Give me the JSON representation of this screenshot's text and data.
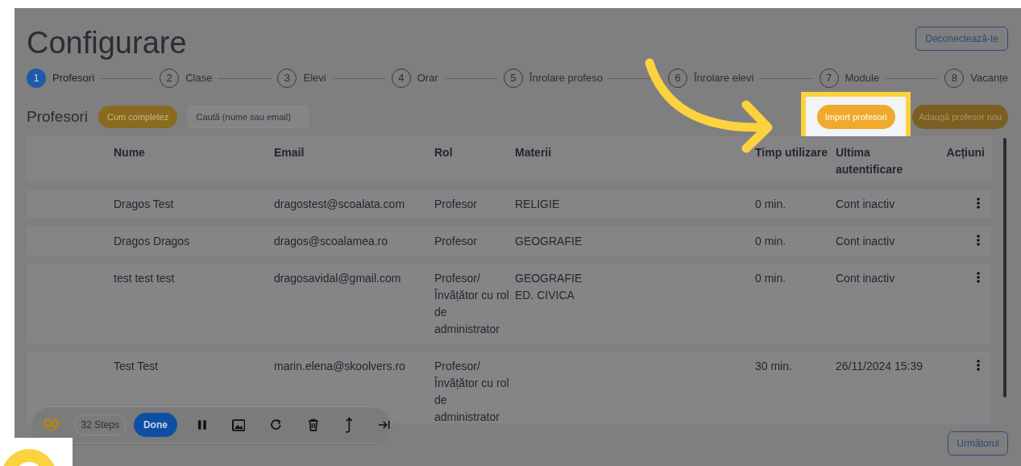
{
  "title": "Configurare",
  "logout_button": "Deconectează-te",
  "steps": [
    {
      "number": "1",
      "label": "Profesori",
      "selected": true
    },
    {
      "number": "2",
      "label": "Clase",
      "selected": false
    },
    {
      "number": "3",
      "label": "Elevi",
      "selected": false
    },
    {
      "number": "4",
      "label": "Orar",
      "selected": false
    },
    {
      "number": "5",
      "label": "Înrolare profeso",
      "selected": false
    },
    {
      "number": "6",
      "label": "Înrolare elevi",
      "selected": false
    },
    {
      "number": "7",
      "label": "Module",
      "selected": false
    },
    {
      "number": "8",
      "label": "Vacanțe",
      "selected": false
    }
  ],
  "section_title": "Profesori",
  "help_button": "Cum completez",
  "search": {
    "placeholder": "Caută (nume sau email)"
  },
  "import_button": "Import profesori",
  "add_button": "Adaugă profesor nou",
  "table": {
    "columns": [
      "Nume",
      "Email",
      "Rol",
      "Materii",
      "Timp utilizare",
      "Ultima autentificare",
      "Acțiuni"
    ],
    "rows": [
      {
        "name": "Dragos Test",
        "email": "dragostest@scoalata.com",
        "role": "Profesor",
        "subjects": [
          "RELIGIE"
        ],
        "time": "0 min.",
        "last_login": "Cont inactiv"
      },
      {
        "name": "Dragos Dragos",
        "email": "dragos@scoalamea.ro",
        "role": "Profesor",
        "subjects": [
          "GEOGRAFIE"
        ],
        "time": "0 min.",
        "last_login": "Cont inactiv"
      },
      {
        "name": "test test test",
        "email": "dragosavidal@gmail.com",
        "role": "Profesor/ Învățător cu rol de administrator",
        "subjects": [
          "GEOGRAFIE",
          "ED. CIVICA"
        ],
        "time": "0 min.",
        "last_login": "Cont inactiv"
      },
      {
        "name": "Test Test",
        "email": "marin.elena@skoolvers.ro",
        "role": "Profesor/ Învățător cu rol de administrator",
        "subjects": [],
        "time": "30 min.",
        "last_login": "26/11/2024 15:39"
      }
    ]
  },
  "next_button": "Următorul",
  "recorder": {
    "steps": "32 Steps",
    "done_button": "Done"
  }
}
